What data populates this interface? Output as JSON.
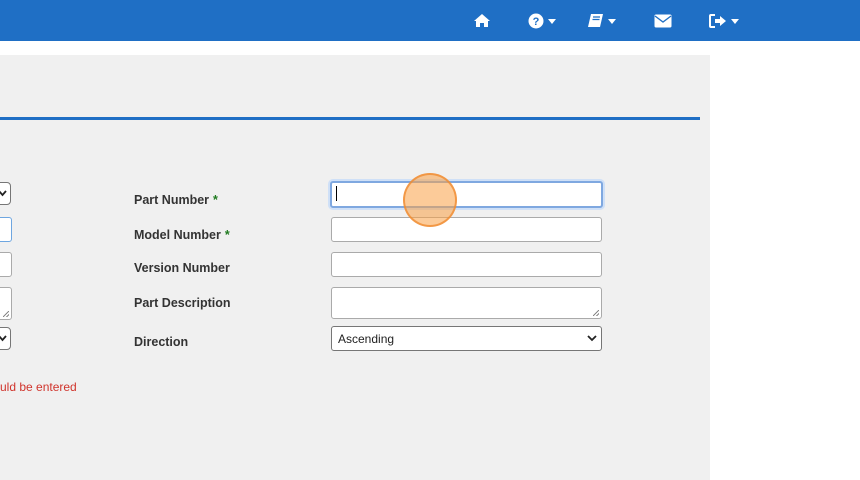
{
  "nav": {
    "items": [
      {
        "name": "home",
        "icon": "home-icon",
        "dropdown": false
      },
      {
        "name": "help",
        "icon": "question-circle-icon",
        "dropdown": true
      },
      {
        "name": "docs",
        "icon": "book-icon",
        "dropdown": true
      },
      {
        "name": "mail",
        "icon": "envelope-icon",
        "dropdown": false
      },
      {
        "name": "logout",
        "icon": "sign-out-icon",
        "dropdown": true
      }
    ]
  },
  "form": {
    "part_number": {
      "label": "Part Number",
      "required_mark": "*",
      "value": ""
    },
    "model_number": {
      "label": "Model Number",
      "required_mark": "*",
      "value": ""
    },
    "version_number": {
      "label": "Version Number",
      "value": ""
    },
    "part_description": {
      "label": "Part Description",
      "value": ""
    },
    "direction": {
      "label": "Direction",
      "selected": "Ascending"
    }
  },
  "error_message": "uld be entered",
  "colors": {
    "accent": "#1f6fc5",
    "panel": "#f0f0f0",
    "required": "#1f7a1f",
    "error": "#d0342c"
  }
}
